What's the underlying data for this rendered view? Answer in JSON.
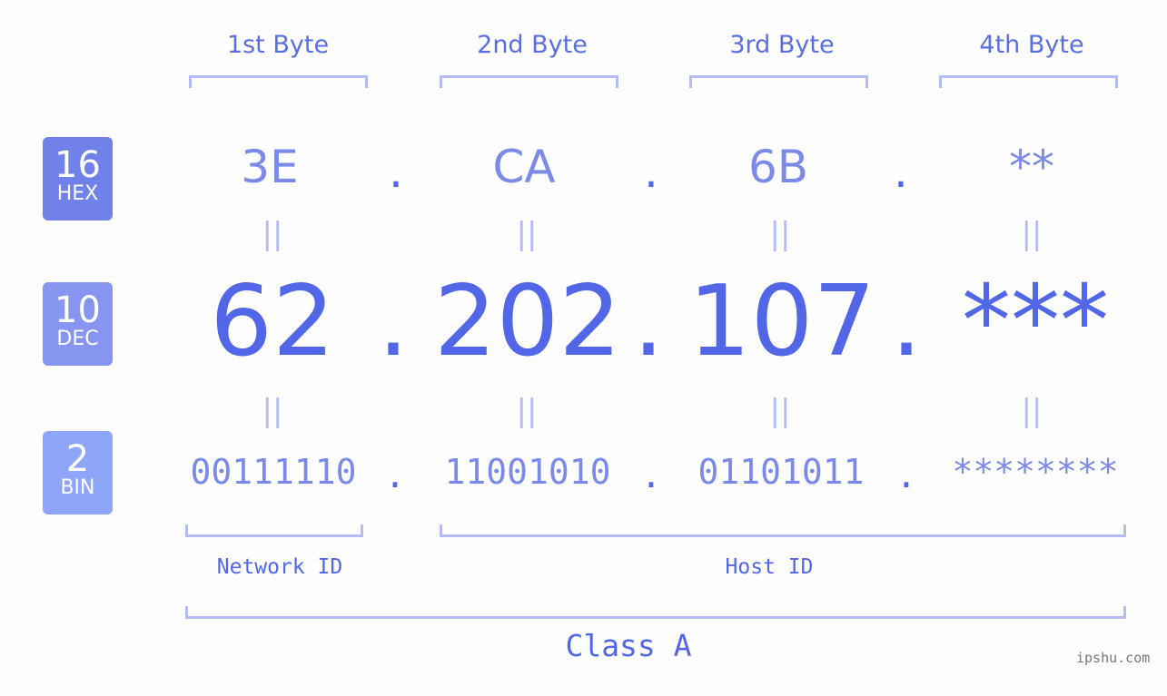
{
  "byte_headers": [
    "1st Byte",
    "2nd Byte",
    "3rd Byte",
    "4th Byte"
  ],
  "badges": [
    {
      "num": "16",
      "label": "HEX",
      "color": "#7181ea"
    },
    {
      "num": "10",
      "label": "DEC",
      "color": "#8595f0"
    },
    {
      "num": "2",
      "label": "BIN",
      "color": "#8fa5f7"
    }
  ],
  "hex": [
    "3E",
    "CA",
    "6B",
    "**"
  ],
  "dec": [
    "62",
    "202",
    "107",
    "***"
  ],
  "bin": [
    "00111110",
    "11001010",
    "01101011",
    "********"
  ],
  "separator": ".",
  "equals": "||",
  "network_label": "Network ID",
  "host_label": "Host ID",
  "class_label": "Class A",
  "watermark": "ipshu.com"
}
